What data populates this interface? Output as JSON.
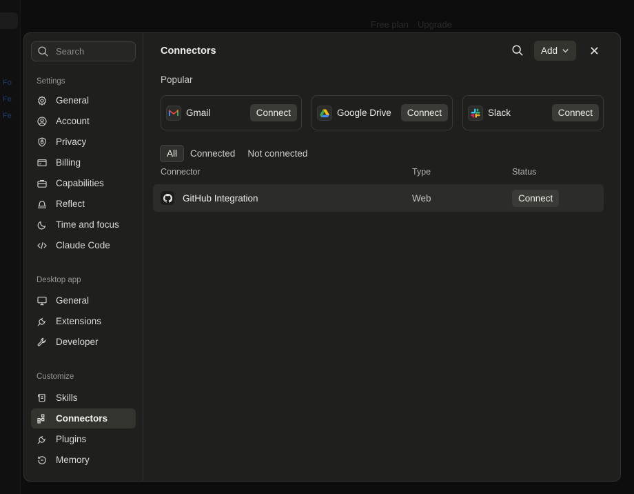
{
  "backdrop": {
    "plan": "Free plan",
    "upgrade": "Upgrade",
    "side_links": [
      "Fo",
      "Fe",
      "Fe"
    ]
  },
  "search": {
    "placeholder": "Search"
  },
  "sidebar": {
    "sections": [
      {
        "title": "Settings",
        "items": [
          {
            "label": "General",
            "icon": "gear-icon"
          },
          {
            "label": "Account",
            "icon": "user-circle-icon"
          },
          {
            "label": "Privacy",
            "icon": "shield-icon"
          },
          {
            "label": "Billing",
            "icon": "credit-card-icon"
          },
          {
            "label": "Capabilities",
            "icon": "briefcase-icon"
          },
          {
            "label": "Reflect",
            "icon": "bell-icon"
          },
          {
            "label": "Time and focus",
            "icon": "moon-icon"
          },
          {
            "label": "Claude Code",
            "icon": "code-icon"
          }
        ]
      },
      {
        "title": "Desktop app",
        "items": [
          {
            "label": "General",
            "icon": "monitor-icon"
          },
          {
            "label": "Extensions",
            "icon": "plug-icon"
          },
          {
            "label": "Developer",
            "icon": "wrench-icon"
          }
        ]
      },
      {
        "title": "Customize",
        "items": [
          {
            "label": "Skills",
            "icon": "scroll-icon"
          },
          {
            "label": "Connectors",
            "icon": "connectors-icon",
            "active": true
          },
          {
            "label": "Plugins",
            "icon": "plug-icon"
          },
          {
            "label": "Memory",
            "icon": "memory-icon"
          }
        ]
      }
    ]
  },
  "header": {
    "title": "Connectors",
    "add_label": "Add"
  },
  "popular": {
    "title": "Popular",
    "cards": [
      {
        "name": "Gmail",
        "icon": "gmail-icon",
        "button": "Connect"
      },
      {
        "name": "Google Drive",
        "icon": "google-drive-icon",
        "button": "Connect"
      },
      {
        "name": "Slack",
        "icon": "slack-icon",
        "button": "Connect"
      }
    ]
  },
  "filters": {
    "tabs": [
      "All",
      "Connected",
      "Not connected"
    ],
    "active": "All"
  },
  "table": {
    "headers": [
      "Connector",
      "Type",
      "Status"
    ],
    "rows": [
      {
        "name": "GitHub Integration",
        "icon": "github-icon",
        "type": "Web",
        "status": "Connect"
      }
    ]
  },
  "colors": {
    "modal_bg": "#1f1f1e",
    "active_item": "#34342f",
    "button_bg": "#3a3a36"
  }
}
